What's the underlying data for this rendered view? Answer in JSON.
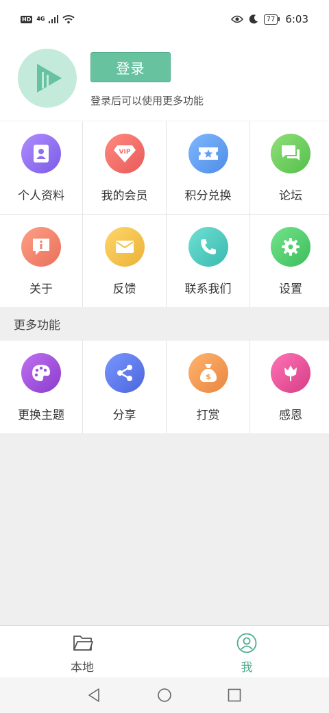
{
  "status_bar": {
    "hd": "HD",
    "network": "4G",
    "battery": "77",
    "time": "6:03"
  },
  "profile": {
    "login_label": "登录",
    "hint": "登录后可以使用更多功能",
    "avatar_icon": "play-logo-icon",
    "accent_color": "#66c29f"
  },
  "grid_main": [
    {
      "label": "个人资料",
      "icon": "contact-card-icon",
      "color": "#8e6ff0"
    },
    {
      "label": "我的会员",
      "icon": "vip-diamond-icon",
      "color": "#ef6f6c"
    },
    {
      "label": "积分兑换",
      "icon": "ticket-star-icon",
      "color": "#5f9ff0"
    },
    {
      "label": "论坛",
      "icon": "chat-bubbles-icon",
      "color": "#6fcf5c"
    },
    {
      "label": "关于",
      "icon": "info-bubble-icon",
      "color": "#ef8468"
    },
    {
      "label": "反馈",
      "icon": "mail-icon",
      "color": "#f1c34c"
    },
    {
      "label": "联系我们",
      "icon": "phone-icon",
      "color": "#4ccfc2"
    },
    {
      "label": "设置",
      "icon": "gear-icon",
      "color": "#4fd16b"
    }
  ],
  "section": {
    "title": "更多功能"
  },
  "grid_more": [
    {
      "label": "更换主题",
      "icon": "palette-icon",
      "color": "#a04fd8"
    },
    {
      "label": "分享",
      "icon": "share-icon",
      "color": "#5b79ea"
    },
    {
      "label": "打赏",
      "icon": "money-bag-icon",
      "color": "#f19a4e"
    },
    {
      "label": "感恩",
      "icon": "tulip-icon",
      "color": "#e64c9a"
    }
  ],
  "bottom_nav": [
    {
      "label": "本地",
      "icon": "folder-icon",
      "active": false
    },
    {
      "label": "我",
      "icon": "user-circle-icon",
      "active": true
    }
  ],
  "system_nav": {
    "back": "back-triangle-icon",
    "home": "home-circle-icon",
    "recents": "recents-square-icon"
  }
}
